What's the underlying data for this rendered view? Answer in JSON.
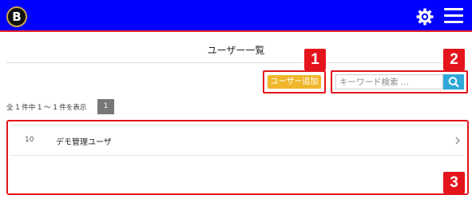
{
  "header": {
    "logo_letter": "B",
    "settings_icon": "gear-icon",
    "menu_icon": "hamburger-menu-icon",
    "bar_color": "#0000ff",
    "accent_line_color": "#e8202a"
  },
  "page": {
    "title": "ユーザー一覧"
  },
  "toolbar": {
    "add_user_label": "ユーザー追加",
    "add_user_color": "#f0b72c",
    "search_placeholder": "キーワード検索 ...",
    "search_value": "",
    "search_icon": "magnifier-icon",
    "search_button_color": "#2fa7d9"
  },
  "pagination": {
    "summary": "全 1 件中 1 ～ 1 件を表示",
    "pages": [
      "1"
    ],
    "current_page": "1"
  },
  "users": [
    {
      "id": "10",
      "name": "デモ管理ユーザ"
    }
  ],
  "annotations": {
    "badge_1": "1",
    "badge_2": "2",
    "badge_3": "3",
    "highlight_color": "#e4141c"
  }
}
